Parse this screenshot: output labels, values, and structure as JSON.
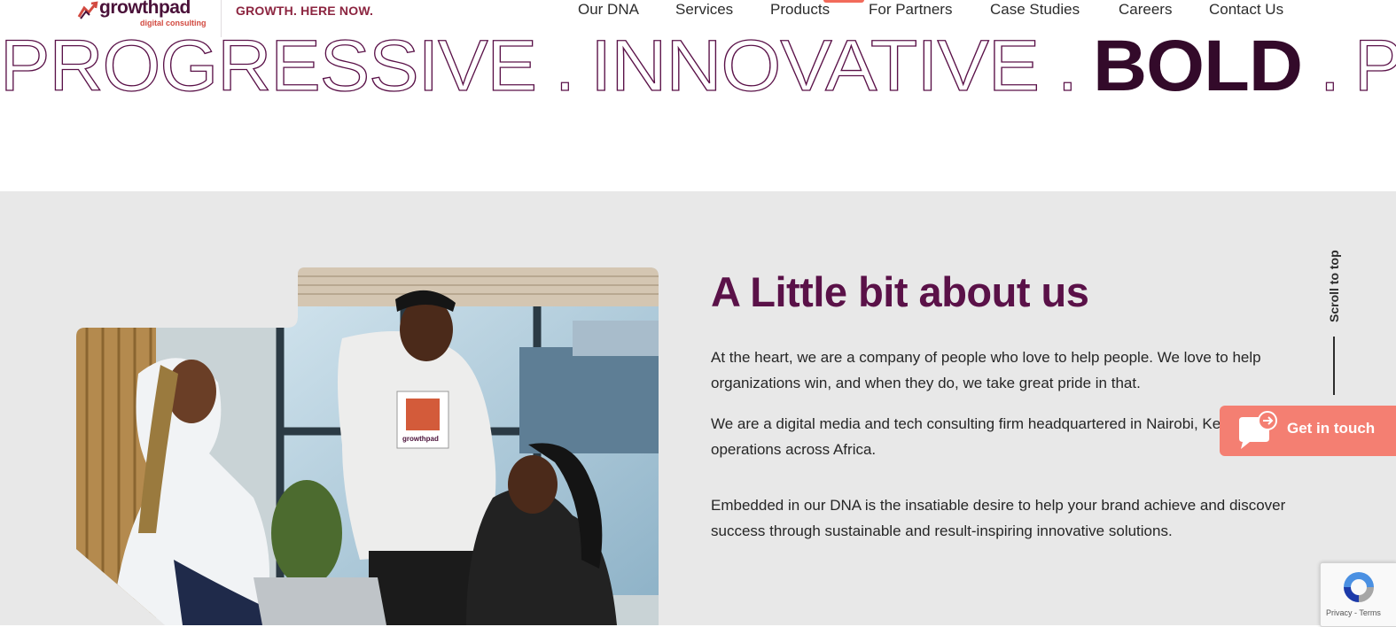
{
  "header": {
    "logo_text": "growthpad",
    "logo_subtext": "digital consulting",
    "tagline": "GROWTH. HERE NOW.",
    "nav": [
      {
        "label": "Our DNA"
      },
      {
        "label": "Services"
      },
      {
        "label": "Products"
      },
      {
        "label": "For Partners"
      },
      {
        "label": "Case Studies"
      },
      {
        "label": "Careers"
      },
      {
        "label": "Contact Us"
      }
    ]
  },
  "marquee": {
    "words": [
      "PROGRESSIVE",
      ".",
      "INNOVATIVE",
      ".",
      "BOLD",
      ".",
      "P"
    ]
  },
  "about": {
    "heading": "A Little bit about us",
    "paragraphs": [
      "At the heart, we are a company of people who love to help people. We love to help organizations win, and when they do, we take great pride in that.",
      "We are a digital media and tech consulting firm headquartered in Nairobi, Kenya, with operations across Africa.",
      "Embedded in our DNA is the insatiable desire to help your brand achieve and discover success through sustainable and result-inspiring innovative solutions."
    ],
    "photo_hoodie_text": "growthpad"
  },
  "floating": {
    "scroll_to_top": "Scroll to top",
    "get_in_touch": "Get in touch",
    "recaptcha_links": "Privacy - Terms"
  },
  "colors": {
    "brand_purple": "#5a1148",
    "brand_coral": "#f47f72",
    "section_bg": "#e8e8e8"
  }
}
